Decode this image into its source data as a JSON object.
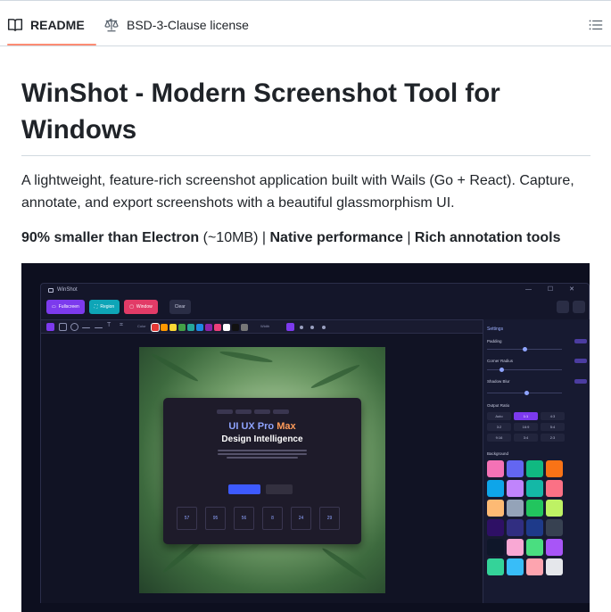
{
  "tabs": {
    "readme_label": "README",
    "license_label": "BSD-3-Clause license"
  },
  "readme": {
    "title": "WinShot - Modern Screenshot Tool for Windows",
    "description": "A lightweight, feature-rich screenshot application built with Wails (Go + React). Capture, annotate, and export screenshots with a beautiful glassmorphism UI.",
    "highlight_1": "90% smaller than Electron",
    "highlight_1_note": " (~10MB) | ",
    "highlight_2": "Native performance",
    "separator": " | ",
    "highlight_3": "Rich annotation tools"
  },
  "screenshot": {
    "app_title": "WinShot",
    "window_controls": "— ☐ ✕",
    "buttons": {
      "fullscreen": "Fullscreen",
      "region": "Region",
      "window": "Window",
      "clear": "Clear"
    },
    "toolbar": {
      "color_label": "Color",
      "width_label": "Width"
    },
    "palette": [
      "#e53935",
      "#ff9800",
      "#fdd835",
      "#43a047",
      "#26a69a",
      "#1e88e5",
      "#8e24aa",
      "#ec407a",
      "#ffffff",
      "#111111",
      "#777777"
    ],
    "canvas_card": {
      "title_main": "UI UX Pro ",
      "title_accent": "Max",
      "subtitle": "Design Intelligence",
      "stats": [
        "57",
        "95",
        "56",
        "8",
        "24",
        "29"
      ]
    },
    "settings": {
      "heading": "Settings",
      "padding": "Padding",
      "corner_radius": "Corner Radius",
      "shadow_blur": "Shadow Blur",
      "output_ratio": "Output Ratio",
      "ratios": [
        "Auto",
        "1:1",
        "4:3",
        "3:2",
        "16:9",
        "5:4",
        "9:16",
        "3:4",
        "2:3"
      ],
      "selected_ratio": "1:1",
      "background": "Background",
      "background_swatches": [
        "#f472b6",
        "#6366f1",
        "#10b981",
        "#f97316",
        "#0ea5e9",
        "#c084fc",
        "#14b8a6",
        "#fb7185",
        "#fdba74",
        "#94a3b8",
        "#22c55e",
        "#bef264",
        "#2e1065",
        "#312e81",
        "#1e3a8a",
        "#374151",
        "#0f172a",
        "#f9a8d4",
        "#4ade80",
        "#a855f7",
        "#34d399",
        "#38bdf8",
        "#fda4af",
        "#e5e7eb"
      ]
    }
  }
}
